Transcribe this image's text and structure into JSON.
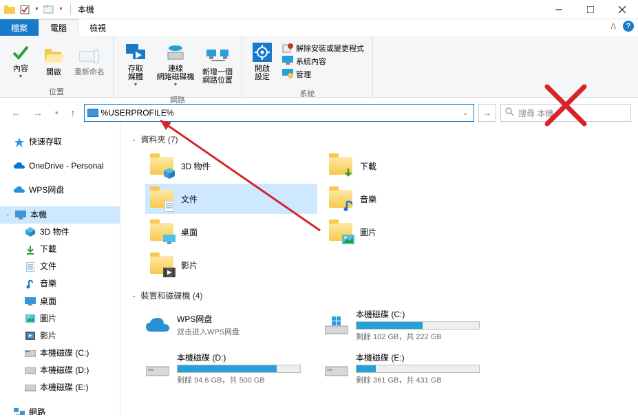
{
  "titlebar": {
    "title": "本機"
  },
  "tabs": {
    "file": "檔案",
    "computer": "電腦",
    "view": "檢視"
  },
  "ribbon": {
    "location": {
      "label": "位置",
      "content": "內容",
      "open": "開啟",
      "rename": "重新命名"
    },
    "network": {
      "label": "網路",
      "media": "存取\n媒體",
      "mapdrive": "連線\n網路磁碟機",
      "addloc": "新增一個\n網路位置"
    },
    "system": {
      "label": "系統",
      "settings": "開啟\n設定",
      "uninstall": "解除安裝或變更程式",
      "props": "系統內容",
      "manage": "管理"
    }
  },
  "addressbar": {
    "value": "%USERPROFILE%"
  },
  "search": {
    "placeholder": "搜尋 本機"
  },
  "sidebar": {
    "quick": "快速存取",
    "onedrive": "OneDrive - Personal",
    "wps": "WPS网盘",
    "thispc": "本機",
    "items": {
      "objects3d": "3D 物件",
      "downloads": "下載",
      "documents": "文件",
      "music": "音樂",
      "desktop": "桌面",
      "pictures": "圖片",
      "videos": "影片",
      "diskC": "本機磁碟 (C:)",
      "diskD": "本機磁碟 (D:)",
      "diskE": "本機磁碟 (E:)"
    },
    "network": "網路"
  },
  "content": {
    "folders_header": "資料夾 (7)",
    "drives_header": "裝置和磁碟機 (4)",
    "folders": {
      "objects3d": "3D 物件",
      "downloads": "下載",
      "documents": "文件",
      "music": "音樂",
      "desktop": "桌面",
      "pictures": "圖片",
      "videos": "影片"
    },
    "drives": {
      "wps": {
        "title": "WPS网盘",
        "sub": "双击进入WPS网盘"
      },
      "c": {
        "title": "本機磁碟 (C:)",
        "sub": "剩餘 102 GB，共 222 GB",
        "fill": 54
      },
      "d": {
        "title": "本機磁碟 (D:)",
        "sub": "剩餘 94.6 GB，共 500 GB",
        "fill": 81
      },
      "e": {
        "title": "本機磁碟 (E:)",
        "sub": "剩餘 361 GB，共 431 GB",
        "fill": 16
      }
    }
  }
}
